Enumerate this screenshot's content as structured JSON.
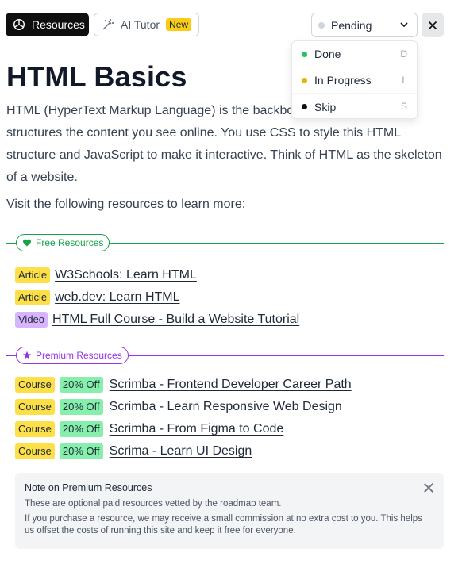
{
  "header": {
    "resources_tab": "Resources",
    "ai_tutor_tab": "AI Tutor",
    "ai_tutor_badge": "New",
    "status_value": "Pending"
  },
  "status_menu": [
    {
      "label": "Done",
      "key": "D",
      "color": "#22c55e"
    },
    {
      "label": "In Progress",
      "key": "L",
      "color": "#eab308"
    },
    {
      "label": "Skip",
      "key": "S",
      "color": "#111111"
    }
  ],
  "content": {
    "title": "HTML Basics",
    "intro": "HTML (HyperText Markup Language) is the backbone of webpages. It structures the content you see online. You use CSS to style this HTML structure and JavaScript to make it interactive. Think of HTML as the skeleton of a website.",
    "visit": "Visit the following resources to learn more:"
  },
  "free_resources": {
    "label": "Free Resources",
    "color": "#16a34a",
    "items": [
      {
        "type": "Article",
        "title": "W3Schools: Learn HTML"
      },
      {
        "type": "Article",
        "title": "web.dev: Learn HTML"
      },
      {
        "type": "Video",
        "title": "HTML Full Course - Build a Website Tutorial"
      }
    ]
  },
  "premium_resources": {
    "label": "Premium Resources",
    "color": "#9333ea",
    "items": [
      {
        "type": "Course",
        "discount": "20% Off",
        "title": "Scrimba - Frontend Developer Career Path"
      },
      {
        "type": "Course",
        "discount": "20% Off",
        "title": "Scrimba - Learn Responsive Web Design"
      },
      {
        "type": "Course",
        "discount": "20% Off",
        "title": "Scrimba - From Figma to Code"
      },
      {
        "type": "Course",
        "discount": "20% Off",
        "title": "Scrima - Learn UI Design"
      }
    ]
  },
  "note": {
    "title": "Note on Premium Resources",
    "line1": "These are optional paid resources vetted by the roadmap team.",
    "line2": "If you purchase a resource, we may receive a small commission at no extra cost to you. This helps us offset the costs of running this site and keep it free for everyone."
  },
  "icons": [
    "resources-icon",
    "ai-wand-icon",
    "chevron-down-icon",
    "close-icon",
    "heart-icon",
    "star-icon"
  ]
}
